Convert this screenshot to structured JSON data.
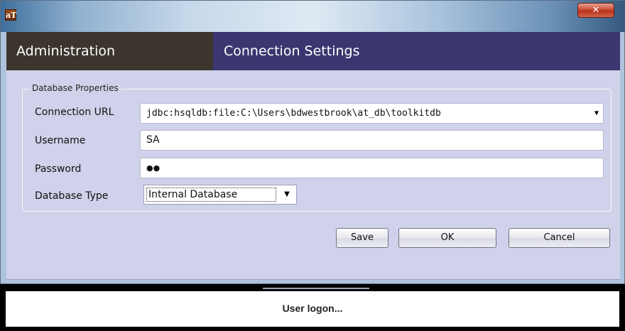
{
  "window": {
    "app_icon_text": "aT",
    "close_glyph": "✕"
  },
  "header": {
    "left_title": "Administration",
    "right_title": "Connection Settings"
  },
  "form": {
    "group_legend": "Database Properties",
    "connection_url": {
      "label": "Connection URL",
      "value": "jdbc:hsqldb:file:C:\\Users\\bdwestbrook\\at_db\\toolkitdb"
    },
    "username": {
      "label": "Username",
      "value": "SA"
    },
    "password": {
      "label": "Password",
      "value": "●●"
    },
    "database_type": {
      "label": "Database Type",
      "value": "Internal Database"
    },
    "dropdown_glyph": "▼"
  },
  "buttons": {
    "save": "Save",
    "ok": "OK",
    "cancel": "Cancel"
  },
  "status": {
    "message": "User logon..."
  },
  "colors": {
    "header_left_bg": "#3c352d",
    "header_right_bg": "#3b3670",
    "panel_bg": "#d0d1ea"
  }
}
